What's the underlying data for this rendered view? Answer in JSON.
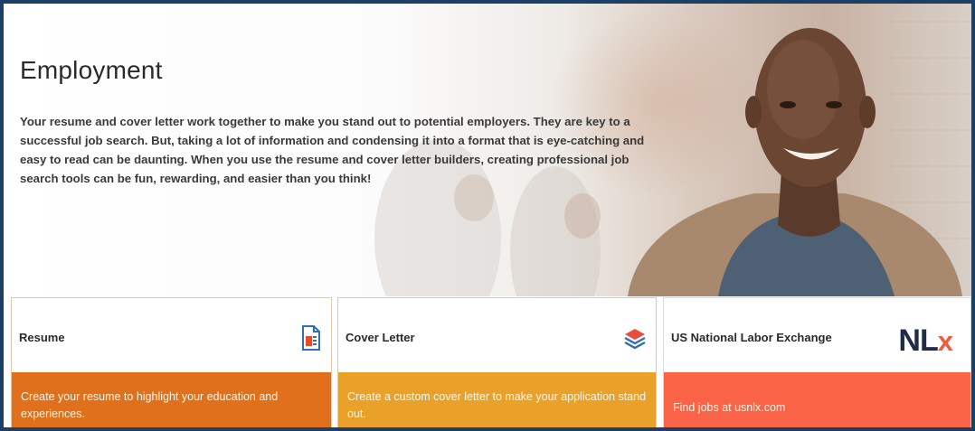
{
  "hero": {
    "title": "Employment",
    "intro": "Your resume and cover letter work together to make you stand out to potential employers. They are key to a successful job search. But, taking a lot of information and condensing it into a format that is eye-catching and easy to read can be daunting. When you use the resume and cover letter builders, creating professional job search tools can be fun, rewarding, and easier than you think!"
  },
  "cards": [
    {
      "label": "Resume",
      "description": "Create your resume to highlight your education and experiences.",
      "icon": "resume-document-icon",
      "color": "#e0701c"
    },
    {
      "label": "Cover Letter",
      "description": "Create a custom cover letter to make your application stand out.",
      "icon": "layers-stack-icon",
      "color": "#eaa12a"
    },
    {
      "label": "US National Labor Exchange",
      "description": "Find jobs at usnlx.com",
      "logo_main": "NL",
      "logo_accent": "x",
      "color": "#fa6346"
    }
  ],
  "colors": {
    "frame": "#1c3f66",
    "title": "#2b2b2b",
    "nlx_navy": "#1f2d48",
    "nlx_red": "#f15a3c"
  }
}
